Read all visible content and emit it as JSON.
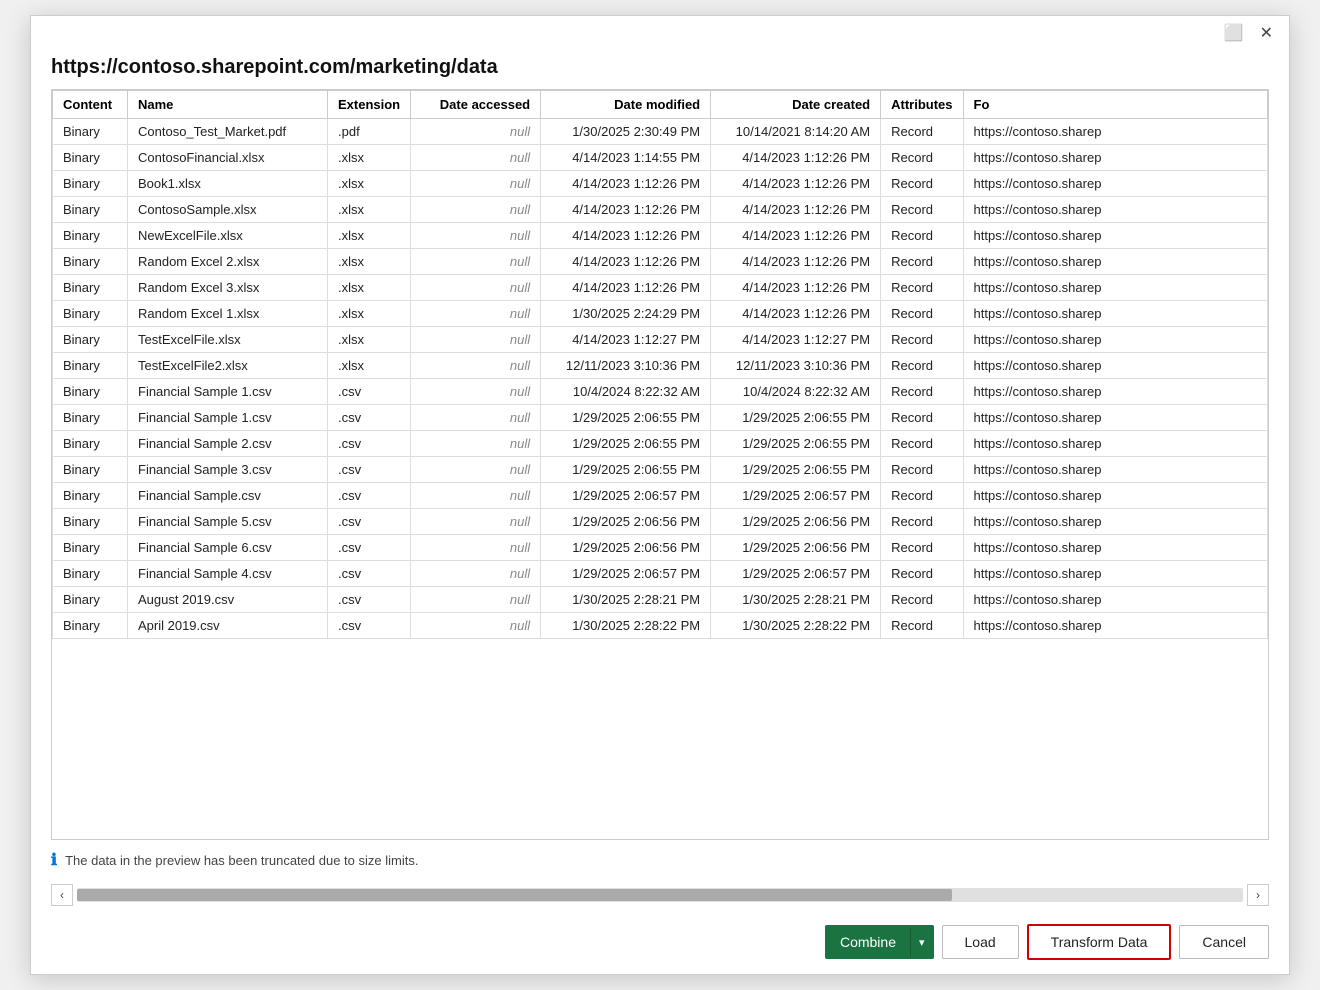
{
  "dialog": {
    "title": "https://contoso.sharepoint.com/marketing/data",
    "info_message": "The data in the preview has been truncated due to size limits."
  },
  "titlebar": {
    "restore_label": "⬜",
    "close_label": "✕"
  },
  "table": {
    "columns": [
      "Content",
      "Name",
      "Extension",
      "Date accessed",
      "Date modified",
      "Date created",
      "Attributes",
      "Fo"
    ],
    "rows": [
      [
        "Binary",
        "Contoso_Test_Market.pdf",
        ".pdf",
        "null",
        "1/30/2025 2:30:49 PM",
        "10/14/2021 8:14:20 AM",
        "Record",
        "https://contoso.sharep"
      ],
      [
        "Binary",
        "ContosoFinancial.xlsx",
        ".xlsx",
        "null",
        "4/14/2023 1:14:55 PM",
        "4/14/2023 1:12:26 PM",
        "Record",
        "https://contoso.sharep"
      ],
      [
        "Binary",
        "Book1.xlsx",
        ".xlsx",
        "null",
        "4/14/2023 1:12:26 PM",
        "4/14/2023 1:12:26 PM",
        "Record",
        "https://contoso.sharep"
      ],
      [
        "Binary",
        "ContosoSample.xlsx",
        ".xlsx",
        "null",
        "4/14/2023 1:12:26 PM",
        "4/14/2023 1:12:26 PM",
        "Record",
        "https://contoso.sharep"
      ],
      [
        "Binary",
        "NewExcelFile.xlsx",
        ".xlsx",
        "null",
        "4/14/2023 1:12:26 PM",
        "4/14/2023 1:12:26 PM",
        "Record",
        "https://contoso.sharep"
      ],
      [
        "Binary",
        "Random Excel 2.xlsx",
        ".xlsx",
        "null",
        "4/14/2023 1:12:26 PM",
        "4/14/2023 1:12:26 PM",
        "Record",
        "https://contoso.sharep"
      ],
      [
        "Binary",
        "Random Excel 3.xlsx",
        ".xlsx",
        "null",
        "4/14/2023 1:12:26 PM",
        "4/14/2023 1:12:26 PM",
        "Record",
        "https://contoso.sharep"
      ],
      [
        "Binary",
        "Random Excel 1.xlsx",
        ".xlsx",
        "null",
        "1/30/2025 2:24:29 PM",
        "4/14/2023 1:12:26 PM",
        "Record",
        "https://contoso.sharep"
      ],
      [
        "Binary",
        "TestExcelFile.xlsx",
        ".xlsx",
        "null",
        "4/14/2023 1:12:27 PM",
        "4/14/2023 1:12:27 PM",
        "Record",
        "https://contoso.sharep"
      ],
      [
        "Binary",
        "TestExcelFile2.xlsx",
        ".xlsx",
        "null",
        "12/11/2023 3:10:36 PM",
        "12/11/2023 3:10:36 PM",
        "Record",
        "https://contoso.sharep"
      ],
      [
        "Binary",
        "Financial Sample 1.csv",
        ".csv",
        "null",
        "10/4/2024 8:22:32 AM",
        "10/4/2024 8:22:32 AM",
        "Record",
        "https://contoso.sharep"
      ],
      [
        "Binary",
        "Financial Sample 1.csv",
        ".csv",
        "null",
        "1/29/2025 2:06:55 PM",
        "1/29/2025 2:06:55 PM",
        "Record",
        "https://contoso.sharep"
      ],
      [
        "Binary",
        "Financial Sample 2.csv",
        ".csv",
        "null",
        "1/29/2025 2:06:55 PM",
        "1/29/2025 2:06:55 PM",
        "Record",
        "https://contoso.sharep"
      ],
      [
        "Binary",
        "Financial Sample 3.csv",
        ".csv",
        "null",
        "1/29/2025 2:06:55 PM",
        "1/29/2025 2:06:55 PM",
        "Record",
        "https://contoso.sharep"
      ],
      [
        "Binary",
        "Financial Sample.csv",
        ".csv",
        "null",
        "1/29/2025 2:06:57 PM",
        "1/29/2025 2:06:57 PM",
        "Record",
        "https://contoso.sharep"
      ],
      [
        "Binary",
        "Financial Sample 5.csv",
        ".csv",
        "null",
        "1/29/2025 2:06:56 PM",
        "1/29/2025 2:06:56 PM",
        "Record",
        "https://contoso.sharep"
      ],
      [
        "Binary",
        "Financial Sample 6.csv",
        ".csv",
        "null",
        "1/29/2025 2:06:56 PM",
        "1/29/2025 2:06:56 PM",
        "Record",
        "https://contoso.sharep"
      ],
      [
        "Binary",
        "Financial Sample 4.csv",
        ".csv",
        "null",
        "1/29/2025 2:06:57 PM",
        "1/29/2025 2:06:57 PM",
        "Record",
        "https://contoso.sharep"
      ],
      [
        "Binary",
        "August 2019.csv",
        ".csv",
        "null",
        "1/30/2025 2:28:21 PM",
        "1/30/2025 2:28:21 PM",
        "Record",
        "https://contoso.sharep"
      ],
      [
        "Binary",
        "April 2019.csv",
        ".csv",
        "null",
        "1/30/2025 2:28:22 PM",
        "1/30/2025 2:28:22 PM",
        "Record",
        "https://contoso.sharep"
      ]
    ]
  },
  "footer": {
    "combine_label": "Combine",
    "combine_arrow": "▾",
    "load_label": "Load",
    "transform_label": "Transform Data",
    "cancel_label": "Cancel"
  }
}
